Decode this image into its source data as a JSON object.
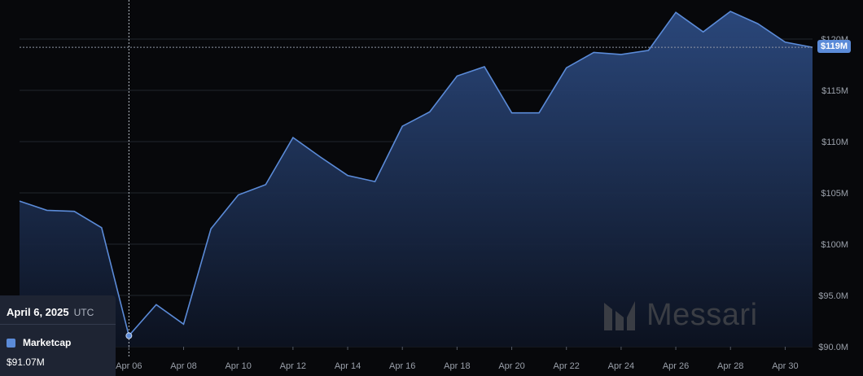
{
  "chart_data": {
    "type": "area",
    "series": [
      {
        "name": "Marketcap",
        "color": "#5b8bd8",
        "x": [
          "2025-04-02",
          "2025-04-03",
          "2025-04-04",
          "2025-04-05",
          "2025-04-06",
          "2025-04-07",
          "2025-04-08",
          "2025-04-09",
          "2025-04-10",
          "2025-04-11",
          "2025-04-12",
          "2025-04-13",
          "2025-04-14",
          "2025-04-15",
          "2025-04-16",
          "2025-04-17",
          "2025-04-18",
          "2025-04-19",
          "2025-04-20",
          "2025-04-21",
          "2025-04-22",
          "2025-04-23",
          "2025-04-24",
          "2025-04-25",
          "2025-04-26",
          "2025-04-27",
          "2025-04-28",
          "2025-04-29",
          "2025-04-30",
          "2025-05-01"
        ],
        "values": [
          104.2,
          103.3,
          103.2,
          101.6,
          91.07,
          94.1,
          92.2,
          101.5,
          104.8,
          105.8,
          110.4,
          108.5,
          106.7,
          106.1,
          111.5,
          112.9,
          116.4,
          117.3,
          112.8,
          112.8,
          117.2,
          118.7,
          118.5,
          118.9,
          122.6,
          120.7,
          122.7,
          121.5,
          119.7,
          119.2
        ]
      }
    ],
    "ylim": [
      90,
      121
    ],
    "y_ticks": [
      "$90.0M",
      "$95.0M",
      "$100M",
      "$105M",
      "$110M",
      "$115M",
      "$120M"
    ],
    "x_ticks": [
      "Apr 06",
      "Apr 08",
      "Apr 10",
      "Apr 12",
      "Apr 14",
      "Apr 16",
      "Apr 18",
      "Apr 20",
      "Apr 22",
      "Apr 24",
      "Apr 26",
      "Apr 28",
      "Apr 30"
    ],
    "grid": true,
    "last_value_label": "$119M",
    "crosshair_date": "2025-04-06",
    "accent_color": "#5b8bd8"
  },
  "tooltip": {
    "date": "April 6, 2025",
    "timezone": "UTC",
    "series_label": "Marketcap",
    "value": "$91.07M"
  },
  "watermark": {
    "text": "Messari",
    "icon": "messari-logo-icon"
  }
}
